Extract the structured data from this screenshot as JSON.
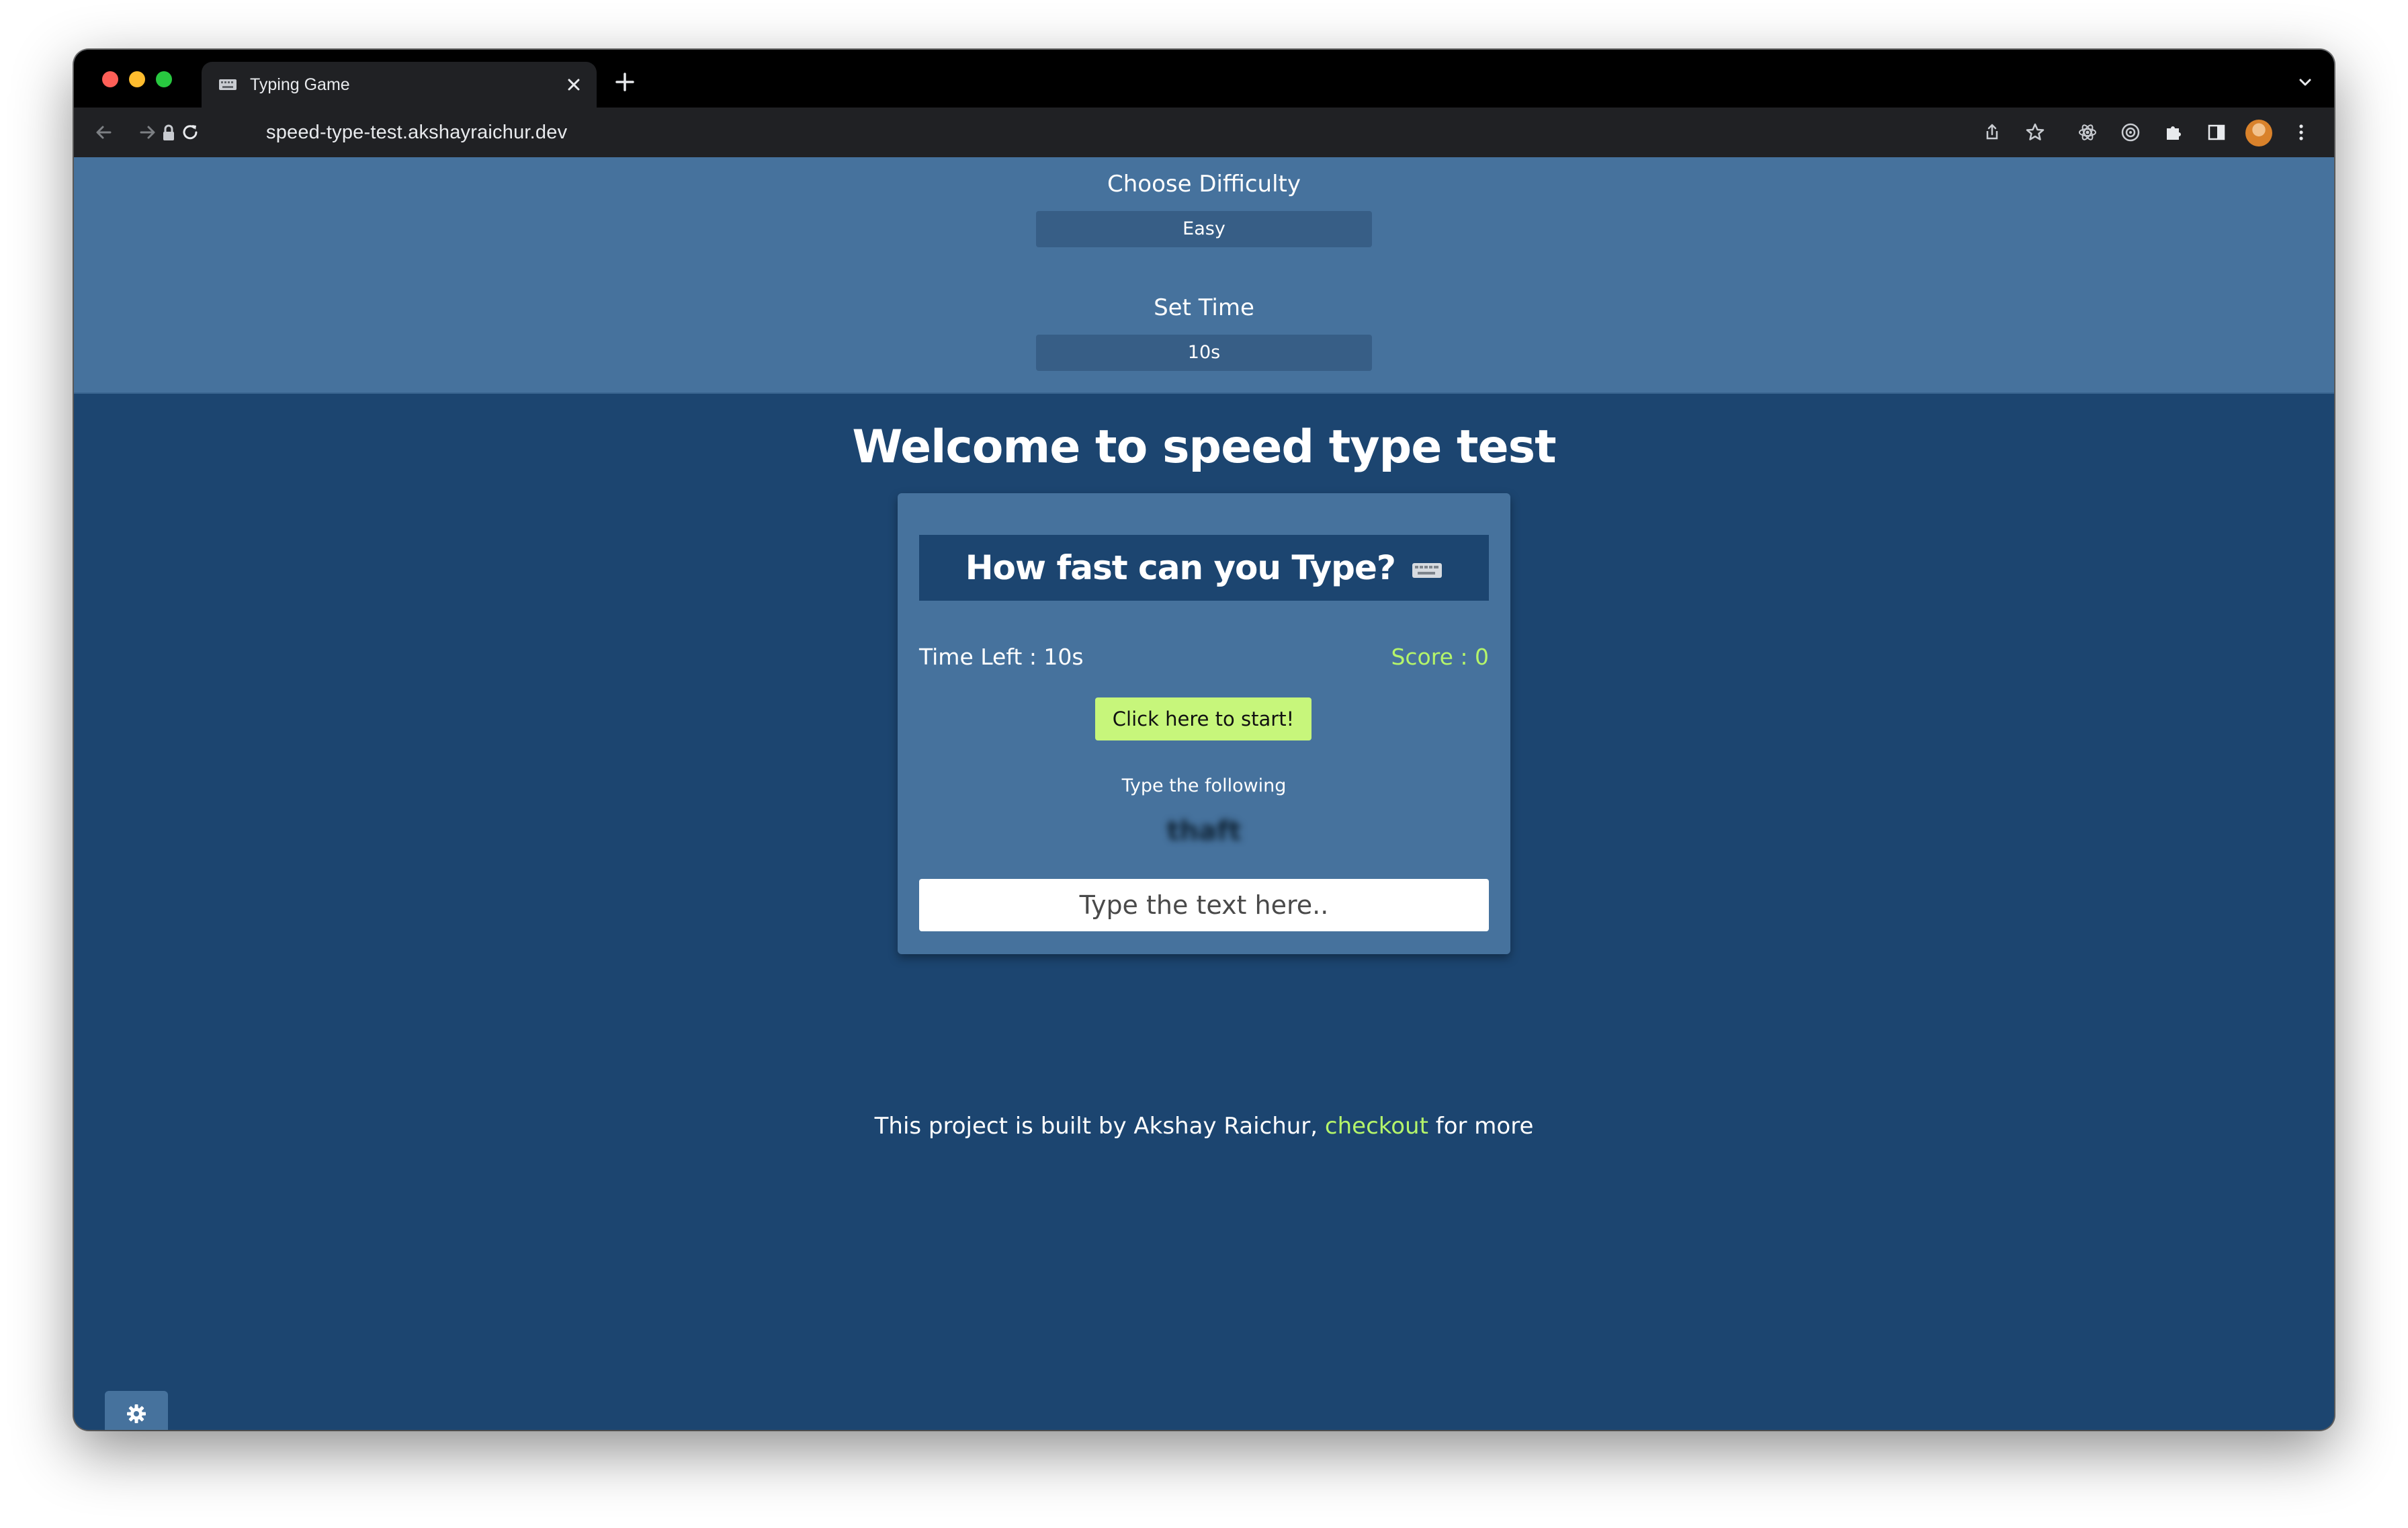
{
  "browser": {
    "tab_title": "Typing Game",
    "url": "speed-type-test.akshayraichur.dev"
  },
  "settings": {
    "difficulty_label": "Choose Difficulty",
    "difficulty_value": "Easy",
    "time_label": "Set Time",
    "time_value": "10s"
  },
  "main": {
    "welcome": "Welcome to speed type test",
    "card_title": "How fast can you Type?",
    "time_left": "Time Left : 10s",
    "score": "Score : 0",
    "start_button": "Click here to start!",
    "instruction": "Type the following",
    "target_word": "thaft",
    "input_placeholder": "Type the text here.."
  },
  "footer": {
    "prefix": "This project is built by Akshay Raichur, ",
    "link": "checkout",
    "suffix": " for more"
  },
  "colors": {
    "accent_green": "#b5f56a",
    "page_bg": "#1c4570",
    "panel_bg": "#46729d"
  }
}
